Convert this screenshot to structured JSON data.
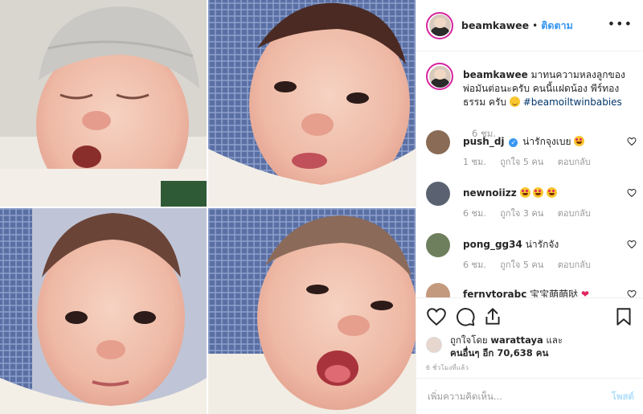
{
  "post": {
    "author": "beamkawee",
    "follow_label": "ติดตาม",
    "caption": {
      "username": "beamkawee",
      "text": "มาทนความหลงลูกของพ่อมันต่อนะครับ คนนี้แฝดน้อง พีร์ทองธรรม ครับ",
      "hashtag": "#beamoiltwinbabies",
      "emoji": "slightly-smiling-face",
      "time": "6 ชม."
    },
    "comments": [
      {
        "username": "push_dj",
        "verified": true,
        "text": "น่ารักจุงเบย",
        "emoji": "heart-eyes",
        "time": "1 ชม.",
        "likes": "ถูกใจ 5 คน",
        "reply": "ตอบกลับ",
        "avatar_color": "#8a6b55"
      },
      {
        "username": "newnoiizz",
        "text": "",
        "emoji": "heart-eyes x3",
        "time": "6 ชม.",
        "likes": "ถูกใจ 3 คน",
        "reply": "ตอบกลับ",
        "avatar_color": "#5a6272"
      },
      {
        "username": "pong_gg34",
        "text": "น่ารักจัง",
        "time": "6 ชม.",
        "likes": "ถูกใจ 5 คน",
        "reply": "ตอบกลับ",
        "avatar_color": "#6e7f5d"
      },
      {
        "username": "fernytorabc",
        "text": "宝宝萌萌哒",
        "emoji": "red-heart",
        "avatar_color": "#c49a7e"
      }
    ],
    "liked_by": {
      "prefix": "ถูกใจโดย",
      "user": "warattaya",
      "and": "และ",
      "others": "คนอื่นๆ อีก 70,638 คน"
    },
    "post_time": "6 ชั่วโมงที่แล้ว",
    "add_comment_placeholder": "เพิ่มความคิดเห็น...",
    "post_label": "โพสต์"
  },
  "colors": {
    "link": "#3897f0",
    "story_ring": "#d6249f",
    "meta": "#999999",
    "hashtag": "#003569"
  },
  "icons": [
    "more-options-icon",
    "heart-icon",
    "comment-icon",
    "share-icon",
    "bookmark-icon"
  ]
}
